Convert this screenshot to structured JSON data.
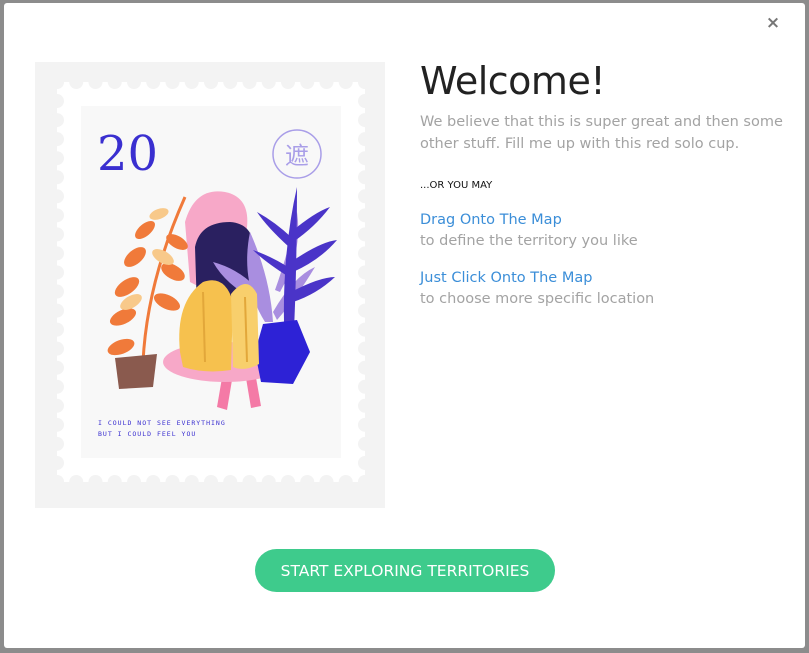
{
  "modal": {
    "close_icon": "×",
    "title": "Welcome!",
    "description": "We believe that this is super great and then some other stuff. Fill me up with this red solo cup.",
    "or_label": "...OR YOU MAY",
    "options": [
      {
        "link": "Drag Onto The Map",
        "description": "to define the territory you like"
      },
      {
        "link": "Just Click Onto The Map",
        "description": "to choose more specific location"
      }
    ],
    "cta_label": "START EXPLORING TERRITORIES"
  },
  "stamp": {
    "number": "20",
    "seal_char": "遮",
    "caption_line1": "I COULD NOT SEE EVERYTHING",
    "caption_line2": "BUT I COULD FEEL YOU",
    "colors": {
      "ink": "#3a2fd0",
      "orange": "#f07a3a",
      "pink": "#f7a8c8",
      "purple": "#a98ee0",
      "yellow": "#f6c14e",
      "blue": "#2d22d6",
      "pot": "#8a5a4e"
    }
  },
  "colors": {
    "accent_green": "#3ecb8c",
    "link_blue": "#3b8ed8",
    "muted_text": "#a3a3a3"
  }
}
